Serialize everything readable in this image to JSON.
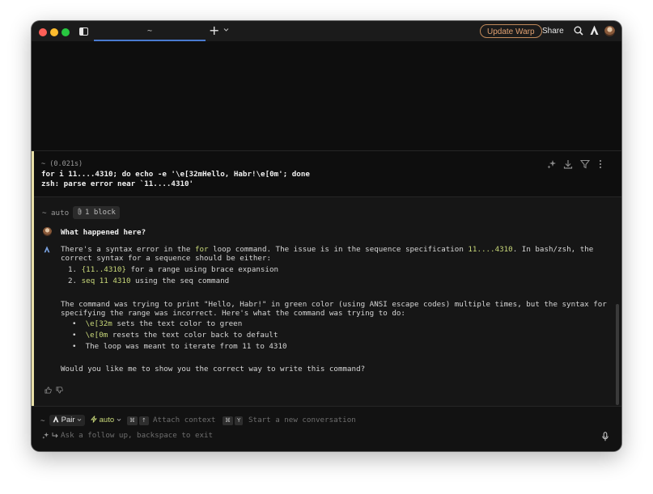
{
  "titlebar": {
    "tab_title": "~",
    "new_tab_symbol": "+",
    "update_button": "Update Warp",
    "share_button": "Share",
    "icons": [
      "sidebar-icon",
      "chevron-down-icon",
      "search-icon",
      "warp-ai-icon",
      "avatar"
    ]
  },
  "block": {
    "prompt_meta": "~ (0.021s)",
    "command": "for i 11....4310; do echo -e '\\e[32mHello, Habr!\\e[0m'; done",
    "error": "zsh: parse error near `11....4310'",
    "actions": [
      "sparkles-icon",
      "download-icon",
      "filter-icon",
      "more-icon"
    ]
  },
  "ai": {
    "context": {
      "prefix": "~",
      "mode": "auto",
      "chip": "1 block"
    },
    "question": "What happened here?",
    "answer": {
      "p1": {
        "a": "There's a syntax error in the ",
        "b": "for",
        "c": " loop command. The issue is in the sequence specification ",
        "d": "11....4310",
        "e": ". In bash/zsh, the",
        "f": "correct syntax for a sequence should be either:"
      },
      "list1": [
        {
          "num": "1.",
          "code": "{11..4310}",
          "text": " for a range using brace expansion"
        },
        {
          "num": "2.",
          "code": "seq 11 4310",
          "text": " using the seq command"
        }
      ],
      "p2_line1": "The command was trying to print \"Hello, Habr!\" in green color (using ANSI escape codes) multiple times, but the syntax for",
      "p2_line2": "specifying the range was incorrect. Here's what the command was trying to do:",
      "list2": [
        {
          "code": "\\e[32m",
          "text": " sets the text color to green"
        },
        {
          "code": "\\e[0m",
          "text": " resets the text color back to default"
        },
        {
          "code": "",
          "text": "The loop was meant to iterate from 11 to 4310"
        }
      ],
      "p3": "Would you like me to show you the correct way to write this command?"
    }
  },
  "input": {
    "prefix": "~",
    "mode": "Pair",
    "model": "auto",
    "shortcut1_key1": "⌘",
    "shortcut1_key2": "↑",
    "shortcut1_label": "Attach context",
    "shortcut2_key1": "⌘",
    "shortcut2_key2": "Y",
    "shortcut2_label": "Start a new conversation",
    "placeholder": "Ask a follow up, backspace to exit"
  },
  "colors": {
    "background": "#0e0e0e",
    "accent_update": "#e0a070",
    "code_highlight": "#c9d97a",
    "tab_underline": "#4a7bd0"
  }
}
